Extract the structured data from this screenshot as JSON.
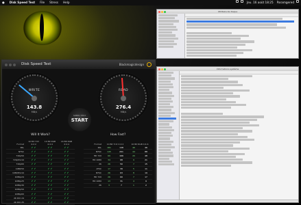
{
  "menubar": {
    "app": "Disk Speed Test",
    "items": [
      "File",
      "Stress",
      "Help"
    ],
    "clock": "Jeu. 16 août 18:25",
    "user": "Paramgered"
  },
  "dst": {
    "title": "Disk Speed Test",
    "brand": "Blackmagicdesign",
    "write": {
      "label": "WRITE",
      "value": "143.8",
      "unit": "MB/s",
      "needle_level": 0.28
    },
    "read": {
      "label": "READ",
      "value": "276.4",
      "unit": "MB/s",
      "needle_level": 0.47
    },
    "start": {
      "top": "SPEED TEST",
      "label": "START"
    },
    "will_it_work": {
      "title": "Will It Work?",
      "columns": [
        "Format",
        "10 Bit YUV 4:2:2",
        "10 Bit RGB 4:4:4",
        "16 Bit RGB 4:4:4"
      ],
      "subcols": [
        "Write",
        "Read"
      ],
      "rows": [
        "PAL",
        "NTSC",
        "720p50",
        "720p59.94",
        "720p60",
        "1080i50",
        "1080i59.94",
        "1080p24",
        "1080p25",
        "1080p30",
        "1080p50",
        "1080p60",
        "2K DCI 24",
        "2K DCI 25",
        "2K DCI 30"
      ]
    },
    "how_fast": {
      "title": "How Fast?",
      "columns": [
        "Format",
        "10 Bit YUV 4:2:2",
        "10 Bit RGB 4:4:4"
      ],
      "subcols": [
        "Write",
        "Read"
      ],
      "rows": [
        {
          "f": "PAL",
          "v": [
            "181",
            "148",
            "46",
            "46"
          ]
        },
        {
          "f": "NTSC",
          "v": [
            "145",
            "291",
            "44",
            "88"
          ]
        },
        {
          "f": "HD 720",
          "v": [
            "69",
            "166",
            "20",
            "48"
          ]
        },
        {
          "f": "HD 1080",
          "v": [
            "34",
            "68",
            "9",
            "21"
          ]
        },
        {
          "f": "2K",
          "v": [
            "26",
            "50",
            "7",
            "15"
          ]
        },
        {
          "f": "ATSC",
          "v": [
            "17",
            "39",
            "5",
            "11"
          ]
        },
        {
          "f": "NTSC",
          "v": [
            "26",
            "63",
            "8",
            "19"
          ]
        },
        {
          "f": "HD 720",
          "v": [
            "26",
            "60",
            "7",
            "17"
          ]
        },
        {
          "f": "HD 1080",
          "v": [
            "13",
            "31",
            "4",
            "9"
          ]
        },
        {
          "f": "2K",
          "v": [
            "3",
            "7",
            "1",
            "2"
          ]
        }
      ]
    }
  },
  "w1": {
    "title": "Utilitaire de disque"
  },
  "w2": {
    "title": "Informations système"
  }
}
